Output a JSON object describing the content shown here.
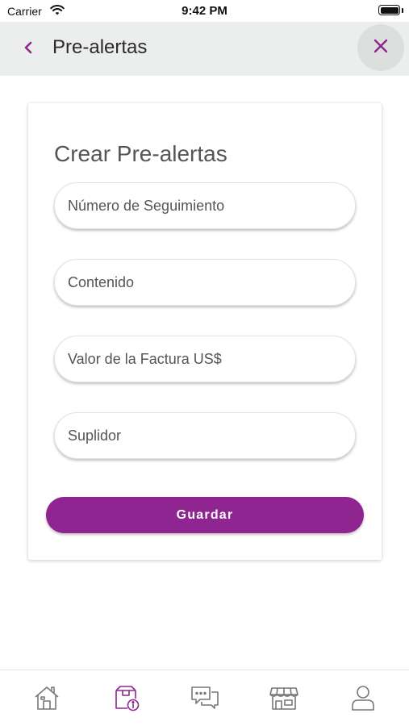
{
  "status_bar": {
    "carrier": "Carrier",
    "time": "9:42 PM",
    "wifi_icon": "wifi-icon",
    "battery_icon": "battery-icon"
  },
  "header": {
    "title": "Pre-alertas",
    "back_icon": "chevron-left-icon",
    "close_icon": "close-icon",
    "background": "#eceeed"
  },
  "form": {
    "title": "Crear Pre-alertas",
    "fields": [
      {
        "placeholder": "Número de Seguimiento",
        "value": ""
      },
      {
        "placeholder": "Contenido",
        "value": ""
      },
      {
        "placeholder": "Valor de la Factura US$",
        "value": ""
      },
      {
        "placeholder": "Suplidor",
        "value": ""
      }
    ],
    "submit_label": "Guardar"
  },
  "tabbar": {
    "items": [
      {
        "icon": "home-icon",
        "active": false
      },
      {
        "icon": "package-info-icon",
        "active": true
      },
      {
        "icon": "chat-icon",
        "active": false
      },
      {
        "icon": "store-icon",
        "active": false
      },
      {
        "icon": "user-icon",
        "active": false
      }
    ]
  },
  "colors": {
    "accent": "#8e2590",
    "icon_inactive": "#777777"
  }
}
